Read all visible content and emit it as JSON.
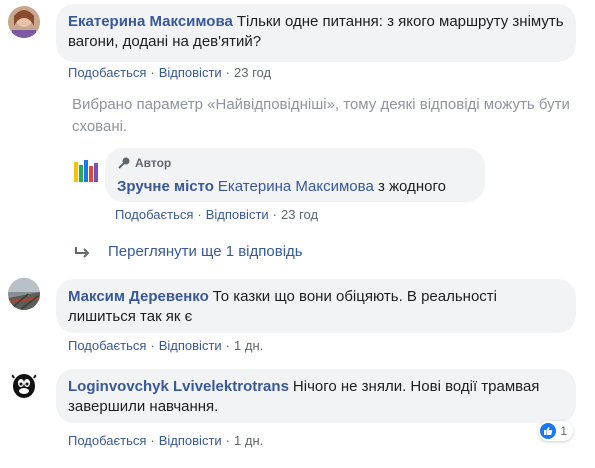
{
  "comments": [
    {
      "author": "Екатерина Максимова",
      "text": "Тільки одне питання: з якого маршруту знімуть вагони, додані на дев'ятий?",
      "like_label": "Подобається",
      "reply_label": "Відповісти",
      "time": "23 год"
    },
    {
      "author_badge": "Автор",
      "author": "Зручне місто",
      "mention": "Екатерина Максимова",
      "text": "з жодного",
      "like_label": "Подобається",
      "reply_label": "Відповісти",
      "time": "23 год"
    },
    {
      "author": "Максим Деревенко",
      "text": "То казки що вони обіцяють. В реальності лишиться так як є",
      "like_label": "Подобається",
      "reply_label": "Відповісти",
      "time": "1 дн."
    },
    {
      "author": "Loginvovchyk Lvivelektrotrans",
      "text": "Нічого не зняли. Нові водії трамвая завершили навчання.",
      "like_label": "Подобається",
      "reply_label": "Відповісти",
      "time": "1 дн.",
      "reaction_count": "1"
    }
  ],
  "notice": "Вибрано параметр «Найвідповідніші», тому деякі відповіді можуть бути сховані.",
  "more_replies": "Переглянути ще 1 відповідь",
  "separator": "·",
  "colors": {
    "link": "#385898",
    "bubble": "#f2f3f5",
    "meta": "#606770",
    "like": "#1877f2"
  },
  "icons": [
    "reply-arrow-icon",
    "microphone-icon",
    "like-reaction-icon"
  ]
}
